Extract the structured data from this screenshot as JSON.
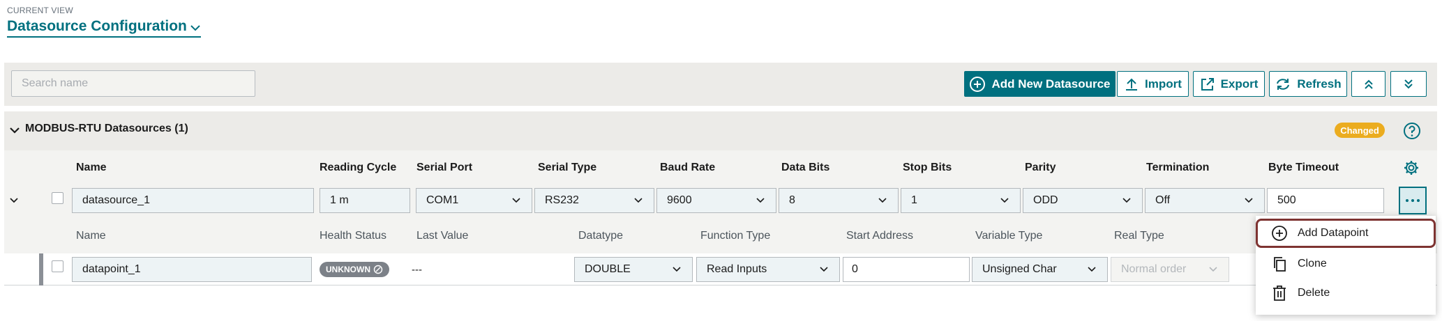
{
  "current_view": {
    "label": "CURRENT VIEW",
    "title": "Datasource Configuration"
  },
  "toolbar": {
    "search_placeholder": "Search name",
    "add_new_label": "Add New Datasource",
    "import_label": "Import",
    "export_label": "Export",
    "refresh_label": "Refresh"
  },
  "group": {
    "title": "MODBUS-RTU Datasources (1)",
    "badge": "Changed"
  },
  "datasource_columns": [
    "Name",
    "Reading Cycle",
    "Serial Port",
    "Serial Type",
    "Baud Rate",
    "Data Bits",
    "Stop Bits",
    "Parity",
    "Termination",
    "Byte Timeout"
  ],
  "datasource": {
    "name": "datasource_1",
    "reading_cycle": "1 m",
    "serial_port": "COM1",
    "serial_type": "RS232",
    "baud_rate": "9600",
    "data_bits": "8",
    "stop_bits": "1",
    "parity": "ODD",
    "termination": "Off",
    "byte_timeout": "500"
  },
  "datapoint_columns": [
    "Name",
    "Health Status",
    "Last Value",
    "Datatype",
    "Function Type",
    "Start Address",
    "Variable Type",
    "Real Type"
  ],
  "datapoint": {
    "name": "datapoint_1",
    "health_status": "UNKNOWN",
    "last_value": "---",
    "datatype": "DOUBLE",
    "function_type": "Read Inputs",
    "start_address": "0",
    "variable_type": "Unsigned Char",
    "real_type": "Normal order"
  },
  "context_menu": {
    "items": [
      "Add Datapoint",
      "Clone",
      "Delete"
    ]
  },
  "colors": {
    "accent": "#00707f",
    "badge_changed": "#ebac1f",
    "health_unknown": "#7c8188",
    "focus_outline": "#7e3331"
  }
}
